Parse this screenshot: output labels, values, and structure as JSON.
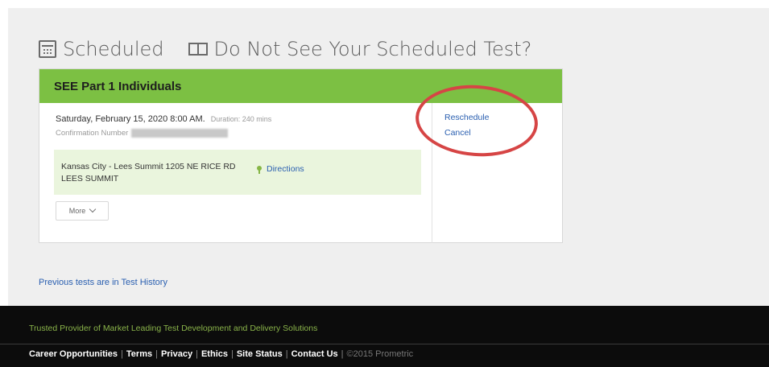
{
  "scheduled_section": {
    "title": "Scheduled",
    "not_see_label": "Do Not See Your Scheduled Test?"
  },
  "appointment": {
    "exam_name": "SEE Part 1 Individuals",
    "date_time": "Saturday, February 15, 2020 8:00 AM.",
    "duration": "Duration: 240 mins",
    "confirmation_label": "Confirmation Number",
    "location": "Kansas City - Lees Summit 1205 NE RICE RD LEES SUMMIT",
    "directions_label": "Directions",
    "more_label": "More",
    "reschedule_label": "Reschedule",
    "cancel_label": "Cancel"
  },
  "history_link": "Previous tests are in Test History",
  "footer": {
    "tagline": "Trusted Provider of Market Leading Test Development and Delivery Solutions",
    "links": [
      "Career Opportunities",
      "Terms",
      "Privacy",
      "Ethics",
      "Site Status",
      "Contact Us"
    ],
    "copyright": "©2015 Prometric"
  },
  "colors": {
    "header_green": "#7cc043",
    "location_bg": "#eaf5dd",
    "link_blue": "#2a5fb0",
    "annotation_red": "#d64545",
    "tagline_green": "#8ab44a"
  },
  "icons": [
    "calendar-icon",
    "id-card-icon",
    "map-pin-icon",
    "chevron-down-icon"
  ]
}
